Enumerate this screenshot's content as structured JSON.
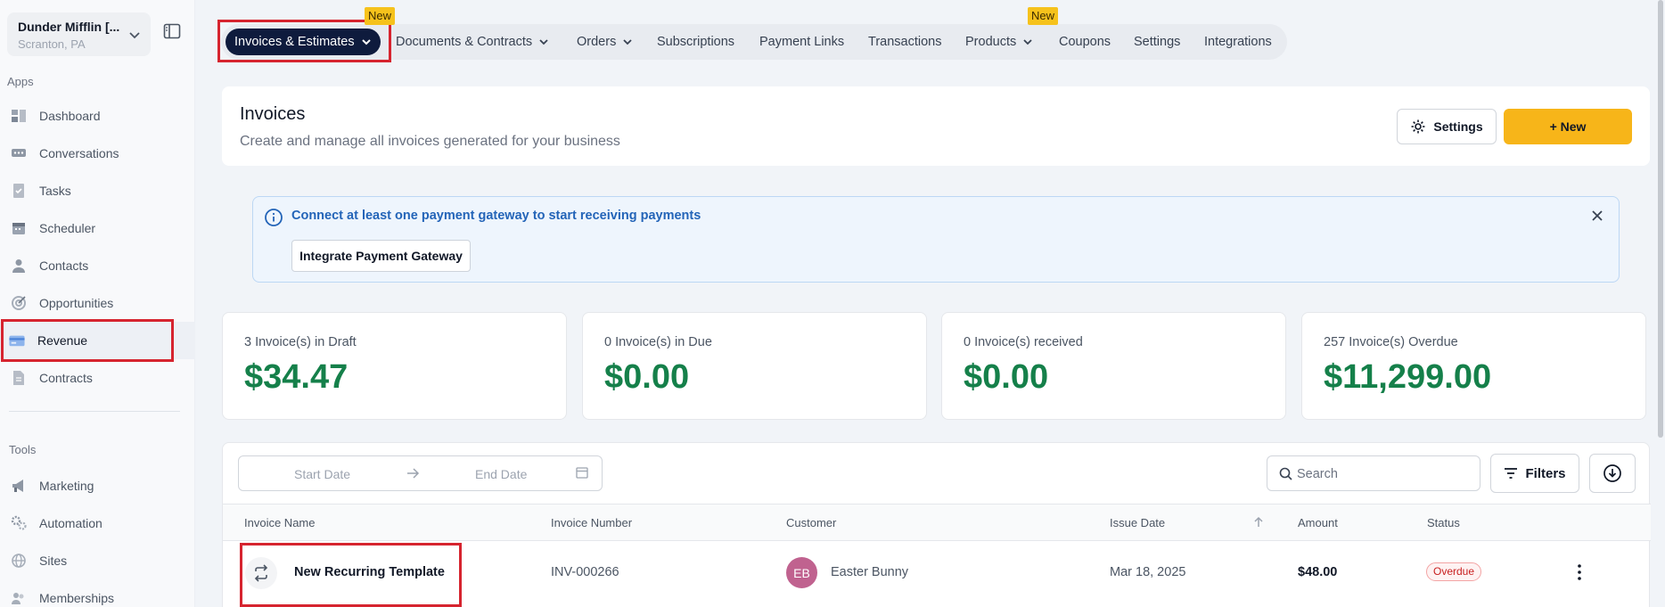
{
  "account": {
    "name": "Dunder Mifflin [...",
    "location": "Scranton, PA"
  },
  "sidebar": {
    "apps_label": "Apps",
    "tools_label": "Tools",
    "apps": [
      {
        "label": "Dashboard",
        "icon": "dashboard-icon"
      },
      {
        "label": "Conversations",
        "icon": "chat-icon"
      },
      {
        "label": "Tasks",
        "icon": "task-icon"
      },
      {
        "label": "Scheduler",
        "icon": "calendar-icon"
      },
      {
        "label": "Contacts",
        "icon": "person-icon"
      },
      {
        "label": "Opportunities",
        "icon": "target-icon"
      },
      {
        "label": "Revenue",
        "icon": "card-icon",
        "active": true
      },
      {
        "label": "Contracts",
        "icon": "document-icon"
      }
    ],
    "tools": [
      {
        "label": "Marketing",
        "icon": "megaphone-icon"
      },
      {
        "label": "Automation",
        "icon": "gears-icon"
      },
      {
        "label": "Sites",
        "icon": "globe-icon"
      },
      {
        "label": "Memberships",
        "icon": "members-icon"
      }
    ]
  },
  "topnav": {
    "badge_new": "New",
    "tabs": [
      {
        "label": "Invoices & Estimates"
      },
      {
        "label": "Documents & Contracts"
      },
      {
        "label": "Orders"
      },
      {
        "label": "Subscriptions"
      },
      {
        "label": "Payment Links"
      },
      {
        "label": "Transactions"
      },
      {
        "label": "Products"
      },
      {
        "label": "Coupons"
      },
      {
        "label": "Settings"
      },
      {
        "label": "Integrations"
      }
    ]
  },
  "header": {
    "title": "Invoices",
    "subtitle": "Create and manage all invoices generated for your business",
    "settings_label": "Settings",
    "new_label": "+ New"
  },
  "alert": {
    "message": "Connect at least one payment gateway to start receiving payments",
    "button_label": "Integrate Payment Gateway"
  },
  "stats": [
    {
      "label": "3 Invoice(s) in Draft",
      "value": "$34.47"
    },
    {
      "label": "0 Invoice(s) in Due",
      "value": "$0.00"
    },
    {
      "label": "0 Invoice(s) received",
      "value": "$0.00"
    },
    {
      "label": "257 Invoice(s) Overdue",
      "value": "$11,299.00"
    }
  ],
  "filters": {
    "start_date_placeholder": "Start Date",
    "end_date_placeholder": "End Date",
    "search_placeholder": "Search",
    "filters_label": "Filters"
  },
  "table": {
    "columns": [
      "Invoice Name",
      "Invoice Number",
      "Customer",
      "Issue Date",
      "Amount",
      "Status"
    ],
    "rows": [
      {
        "name": "New Recurring Template",
        "number": "INV-000266",
        "customer_initials": "EB",
        "customer": "Easter Bunny",
        "issue_date": "Mar 18, 2025",
        "amount": "$48.00",
        "status": "Overdue"
      }
    ]
  },
  "colors": {
    "accent": "#f7b519",
    "active_tab": "#0e1b3d",
    "stat_value": "#15804a",
    "highlight": "#d6242f"
  }
}
